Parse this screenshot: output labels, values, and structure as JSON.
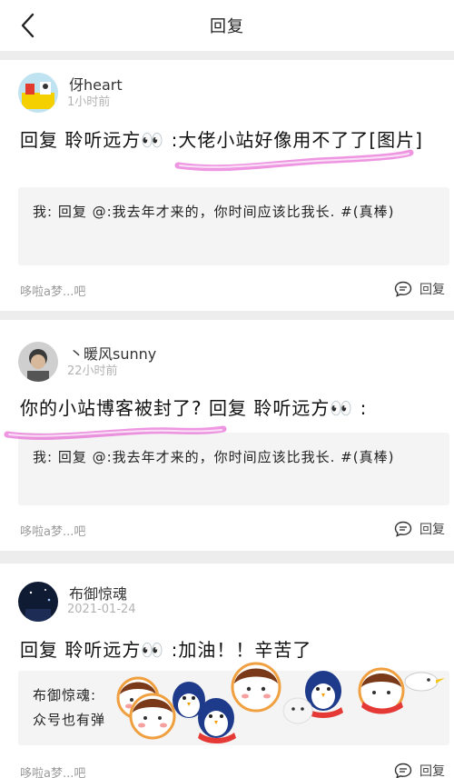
{
  "header": {
    "title": "回复"
  },
  "comments": [
    {
      "username": "伢heart",
      "time": "1小时前",
      "text": "回复 聆听远方👀 :大佬小站好像用不了了[图片]",
      "quote": "我: 回复 @:我去年才来的，你时间应该比我长. #(真棒)",
      "footer_user": "哆啦a梦...吧",
      "reply_label": "回复"
    },
    {
      "username": "丶暖风sunny",
      "time": "22小时前",
      "text": "你的小站博客被封了? 回复 聆听远方👀 :",
      "quote": "我: 回复 @:我去年才来的，你时间应该比我长. #(真棒)",
      "footer_user": "哆啦a梦...吧",
      "reply_label": "回复"
    },
    {
      "username": "布御惊魂",
      "time": "2021-01-24",
      "text": "回复 聆听远方👀 :加油！！辛苦了",
      "quote_line1": "布御惊魂:",
      "quote_line2": "众号也有弹",
      "footer_user": "哆啦a梦...吧",
      "reply_label": "回复"
    }
  ],
  "colors": {
    "highlight": "#e040c8",
    "muted": "#9a9a9a"
  },
  "icons": {
    "back": "chevron-left-icon",
    "reply": "comment-bubble-icon"
  }
}
